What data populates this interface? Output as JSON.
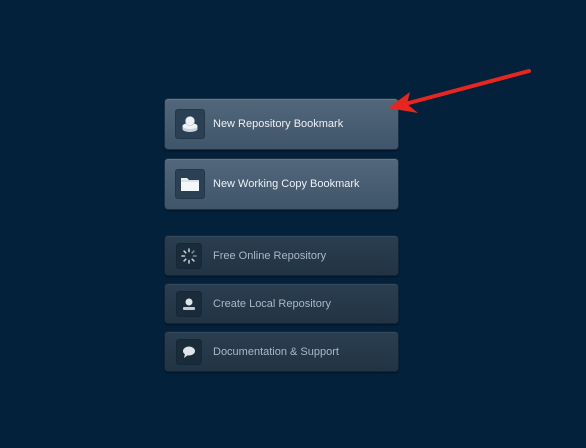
{
  "colors": {
    "background": "#03213a",
    "primary_button": "#465b70",
    "secondary_button": "#26394a",
    "annotation_arrow": "#e8261f"
  },
  "primary_actions": [
    {
      "label": "New Repository Bookmark",
      "icon": "repository-disk-icon"
    },
    {
      "label": "New Working Copy Bookmark",
      "icon": "folder-icon"
    }
  ],
  "secondary_actions": [
    {
      "label": "Free Online Repository",
      "icon": "cloud-spinner-icon"
    },
    {
      "label": "Create Local Repository",
      "icon": "local-repository-icon"
    },
    {
      "label": "Documentation & Support",
      "icon": "speech-bubble-icon"
    }
  ]
}
